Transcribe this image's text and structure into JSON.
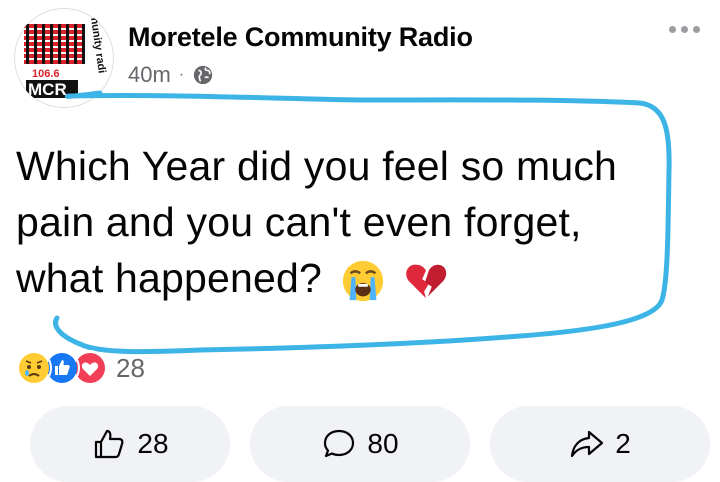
{
  "post": {
    "page_name": "Moretele Community Radio",
    "time": "40m",
    "separator": "·",
    "privacy_icon": "globe-icon",
    "more_icon": "more-options-icon",
    "text": "Which Year did you feel so much pain and you can't even forget, what happened?",
    "emojis": [
      "loudly-crying-face-emoji",
      "broken-heart-emoji"
    ]
  },
  "avatar": {
    "logo_frequency": "106.6",
    "logo_name": "MCR",
    "logo_ring_text": "nunity radi"
  },
  "reactions": {
    "icons": [
      "sad-icon",
      "like-icon",
      "love-icon"
    ],
    "count": "28"
  },
  "actions": {
    "like_count": "28",
    "comment_count": "80",
    "share_count": "2"
  },
  "colors": {
    "annotation": "#3db4e6",
    "button_bg": "#f0f2f5",
    "secondary_text": "#65676b",
    "logo_red": "#d8232a"
  }
}
